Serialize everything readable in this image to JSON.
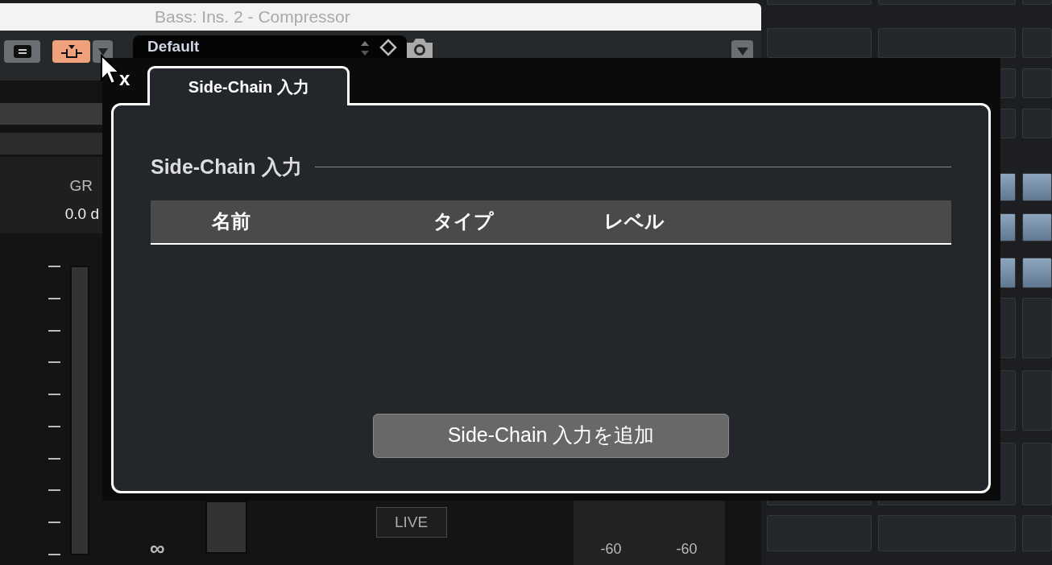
{
  "plugin_window": {
    "title": "Bass: Ins. 2 - Compressor",
    "sidechain_active": true,
    "preset": "Default",
    "gr_label": "GR",
    "gr_value": "0.0 d",
    "infinity_label": "∞",
    "live_button": "LIVE",
    "meter_labels": [
      "-60",
      "-60"
    ]
  },
  "popup": {
    "close": "x",
    "tabs": [
      {
        "label": "Side-Chain 入力",
        "selected": true
      }
    ],
    "section_title": "Side-Chain 入力",
    "table": {
      "columns": [
        "名前",
        "タイプ",
        "レベル"
      ]
    },
    "add_button": "Side-Chain 入力を追加"
  }
}
